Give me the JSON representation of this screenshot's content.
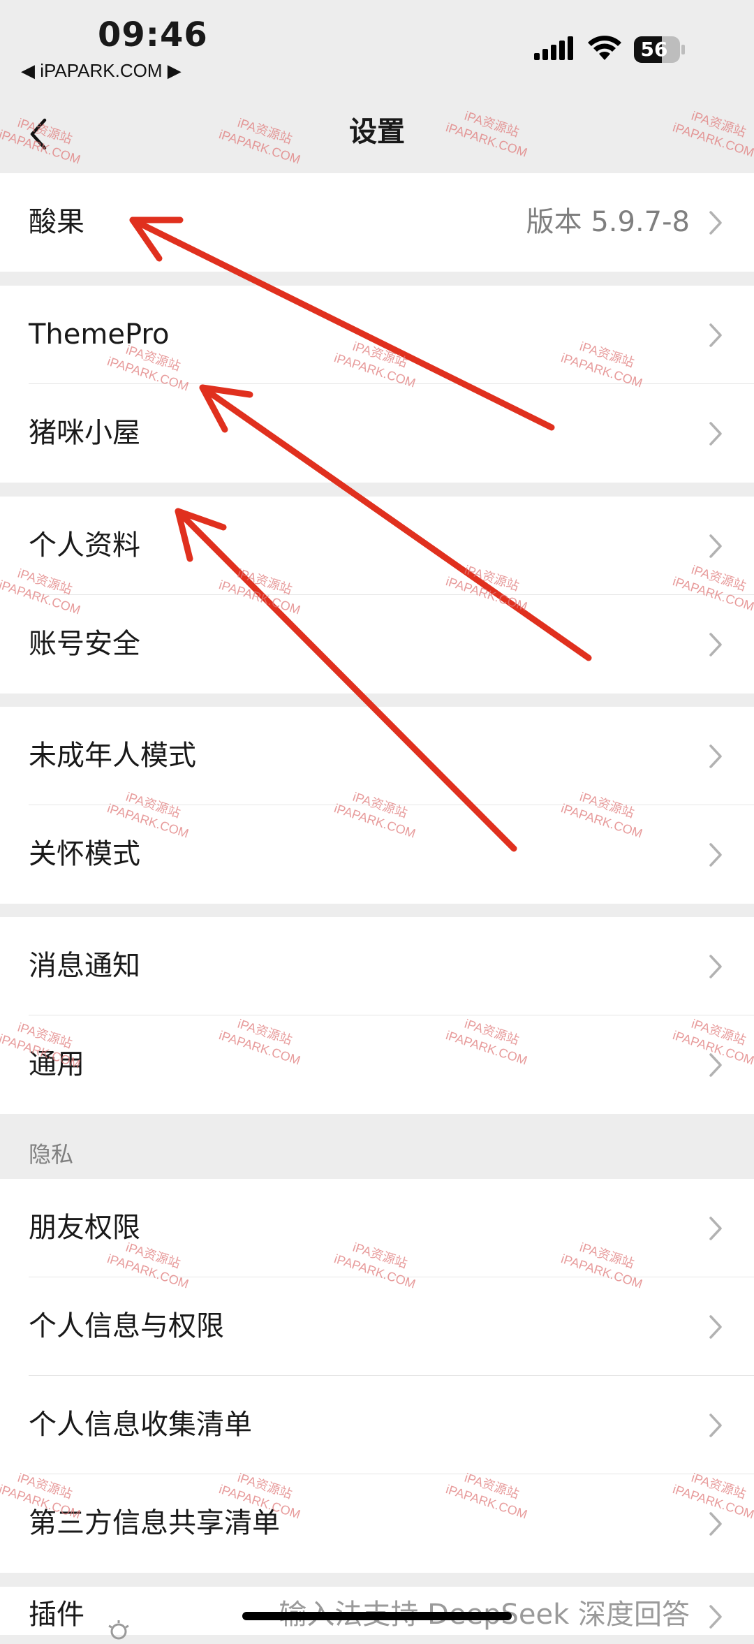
{
  "status_bar": {
    "time": "09:46",
    "carrier": "◀ iPAPARK.COM ▶",
    "battery": "56"
  },
  "nav": {
    "title": "设置"
  },
  "groups": [
    [
      {
        "label": "酸果",
        "value": "版本 5.9.7-8"
      }
    ],
    [
      {
        "label": "ThemePro"
      },
      {
        "label": "猪咪小屋"
      }
    ],
    [
      {
        "label": "个人资料"
      },
      {
        "label": "账号安全"
      }
    ],
    [
      {
        "label": "未成年人模式"
      },
      {
        "label": "关怀模式"
      }
    ],
    [
      {
        "label": "消息通知"
      },
      {
        "label": "通用"
      }
    ],
    [
      {
        "label": "朋友权限"
      },
      {
        "label": "个人信息与权限"
      },
      {
        "label": "个人信息收集清单"
      },
      {
        "label": "第三方信息共享清单"
      }
    ]
  ],
  "privacy_header": "隐私",
  "plugins": {
    "label": "插件",
    "hint": "输入法支持 DeepSeek 深度回答"
  },
  "watermark": {
    "line1": "iPA资源站",
    "line2": "iPAPARK.COM"
  },
  "colors": {
    "background": "#ededed",
    "row_background": "#ffffff",
    "annotation_arrow": "#e0301e",
    "watermark": "#e07a7a"
  }
}
